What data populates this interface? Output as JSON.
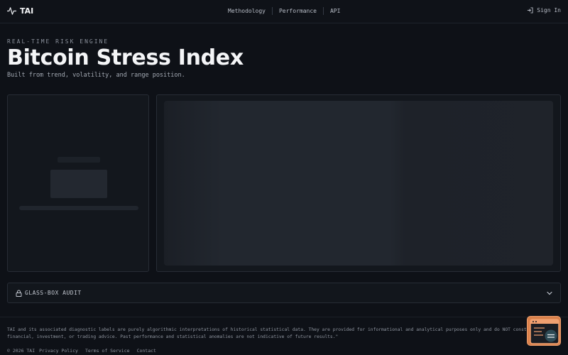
{
  "header": {
    "brand": "TAI",
    "nav": [
      "Methodology",
      "Performance",
      "API"
    ],
    "signin_label": "Sign In"
  },
  "hero": {
    "eyebrow": "REAL-TIME RISK ENGINE",
    "title": "Bitcoin Stress Index",
    "subtitle": "Built from trend, volatility, and range position."
  },
  "audit": {
    "label": "GLASS-BOX AUDIT"
  },
  "footer": {
    "disclaimer": "TAI and its associated diagnostic labels are purely algorithmic interpretations of historical statistical data. They are provided for informational and analytical purposes only and do NOT constitute financial, investment, or trading advice. Past performance and statistical anomalies are not indicative of future results.\"",
    "copyright": "© 2026 TAI",
    "links": [
      "Privacy Policy",
      "Terms of Service",
      "Contact"
    ]
  },
  "colors": {
    "background": "#0e1117",
    "panel": "#13171d",
    "border": "#272c35",
    "widget": "#d9804a"
  },
  "icons": {
    "brand": "pulse-icon",
    "signin": "login-icon",
    "audit": "lock-icon",
    "accordion": "chevron-down-icon",
    "widget": "chat-widget-icon"
  }
}
